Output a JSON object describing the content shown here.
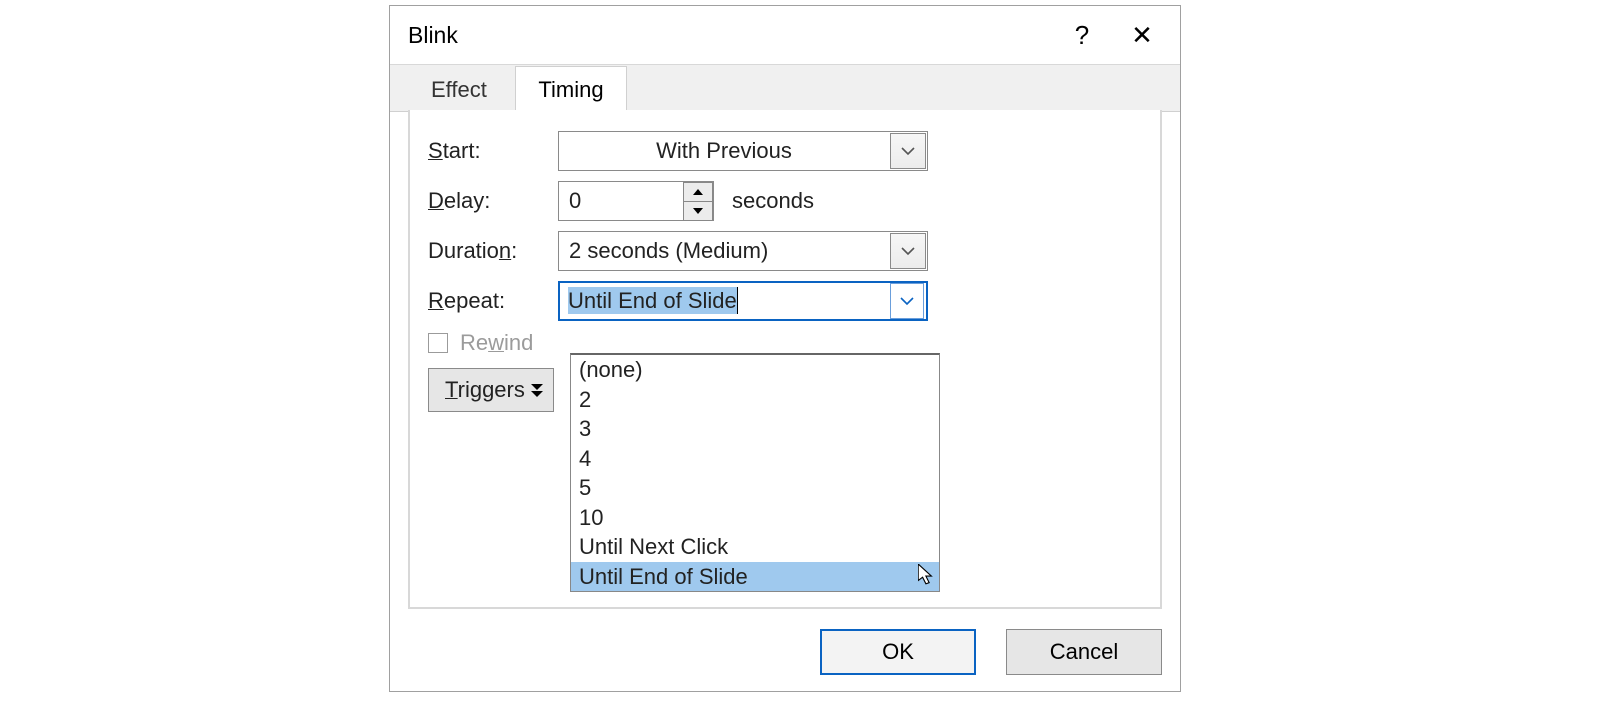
{
  "dialog": {
    "title": "Blink",
    "tabs": {
      "effect": "Effect",
      "timing": "Timing"
    },
    "labels": {
      "start": "Start:",
      "delay": "Delay:",
      "duration": "Duration:",
      "repeat": "Repeat:",
      "rewind": "Rewind",
      "triggers": "Triggers",
      "seconds": "seconds"
    },
    "values": {
      "start": "With Previous",
      "delay": "0",
      "duration": "2 seconds (Medium)",
      "repeat": "Until End of Slide"
    },
    "repeat_options": [
      "(none)",
      "2",
      "3",
      "4",
      "5",
      "10",
      "Until Next Click",
      "Until End of Slide"
    ],
    "buttons": {
      "ok": "OK",
      "cancel": "Cancel"
    }
  }
}
